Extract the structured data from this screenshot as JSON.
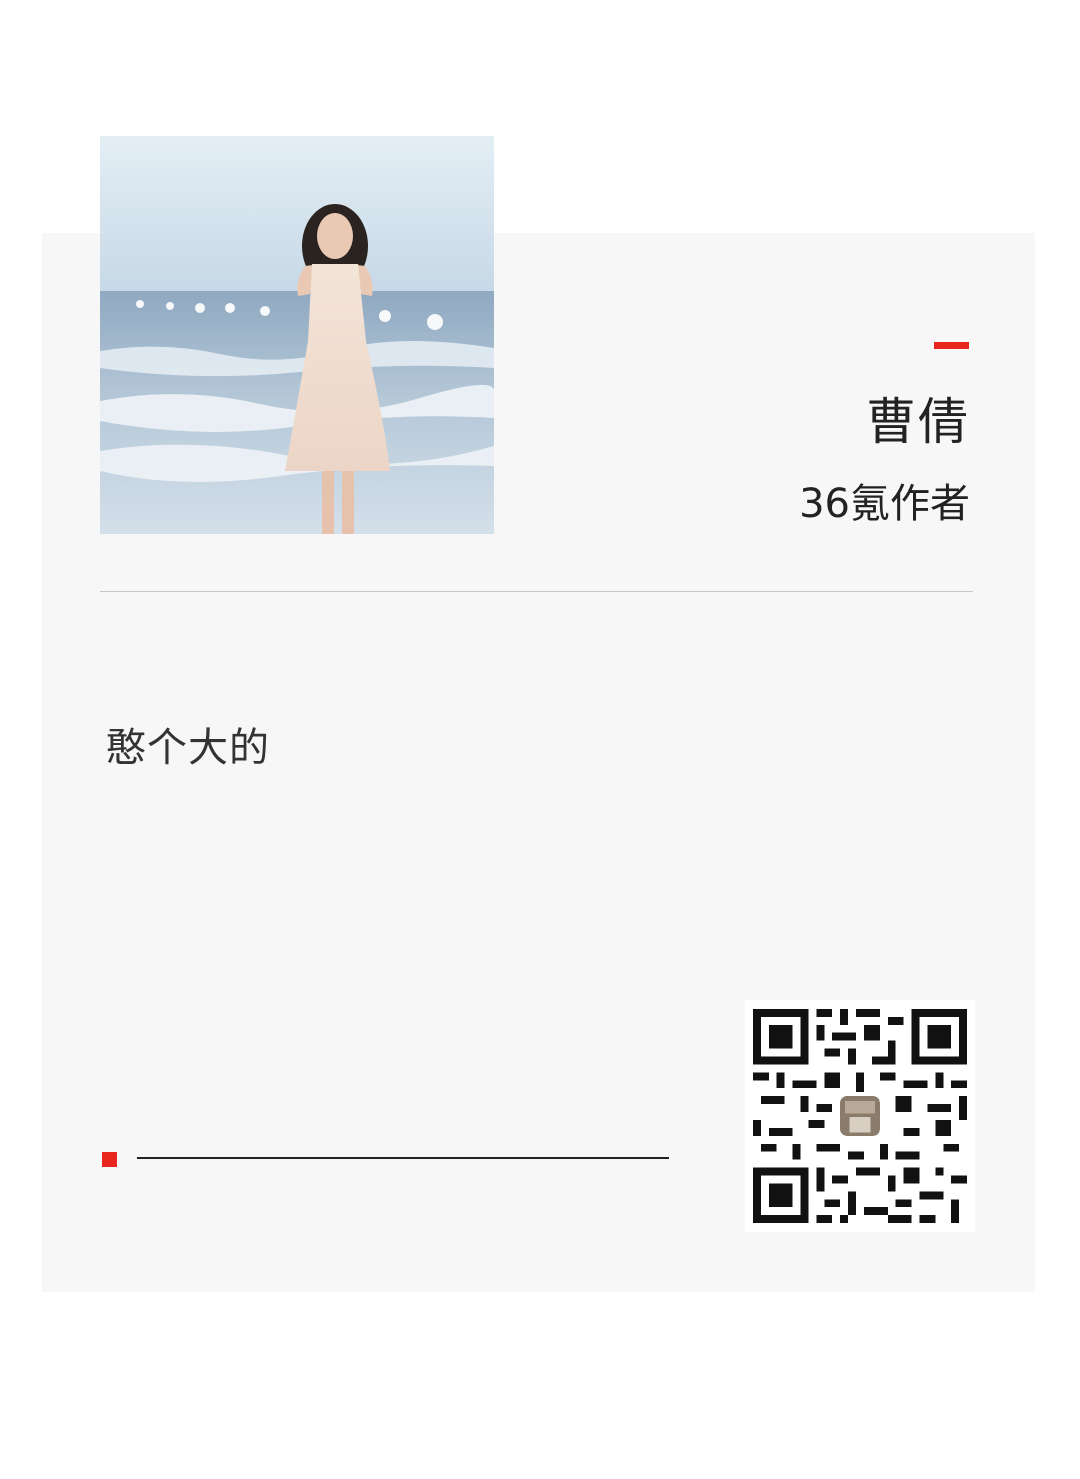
{
  "author": {
    "name": "曹倩",
    "role": "36氪作者",
    "photo_icon": "author-photo-woman-on-beach"
  },
  "bio": {
    "text": "憨个大的"
  },
  "qr": {
    "icon": "qr-code-icon"
  },
  "colors": {
    "accent": "#e8251f",
    "card_background": "#f7f7f7",
    "text": "#222222"
  }
}
